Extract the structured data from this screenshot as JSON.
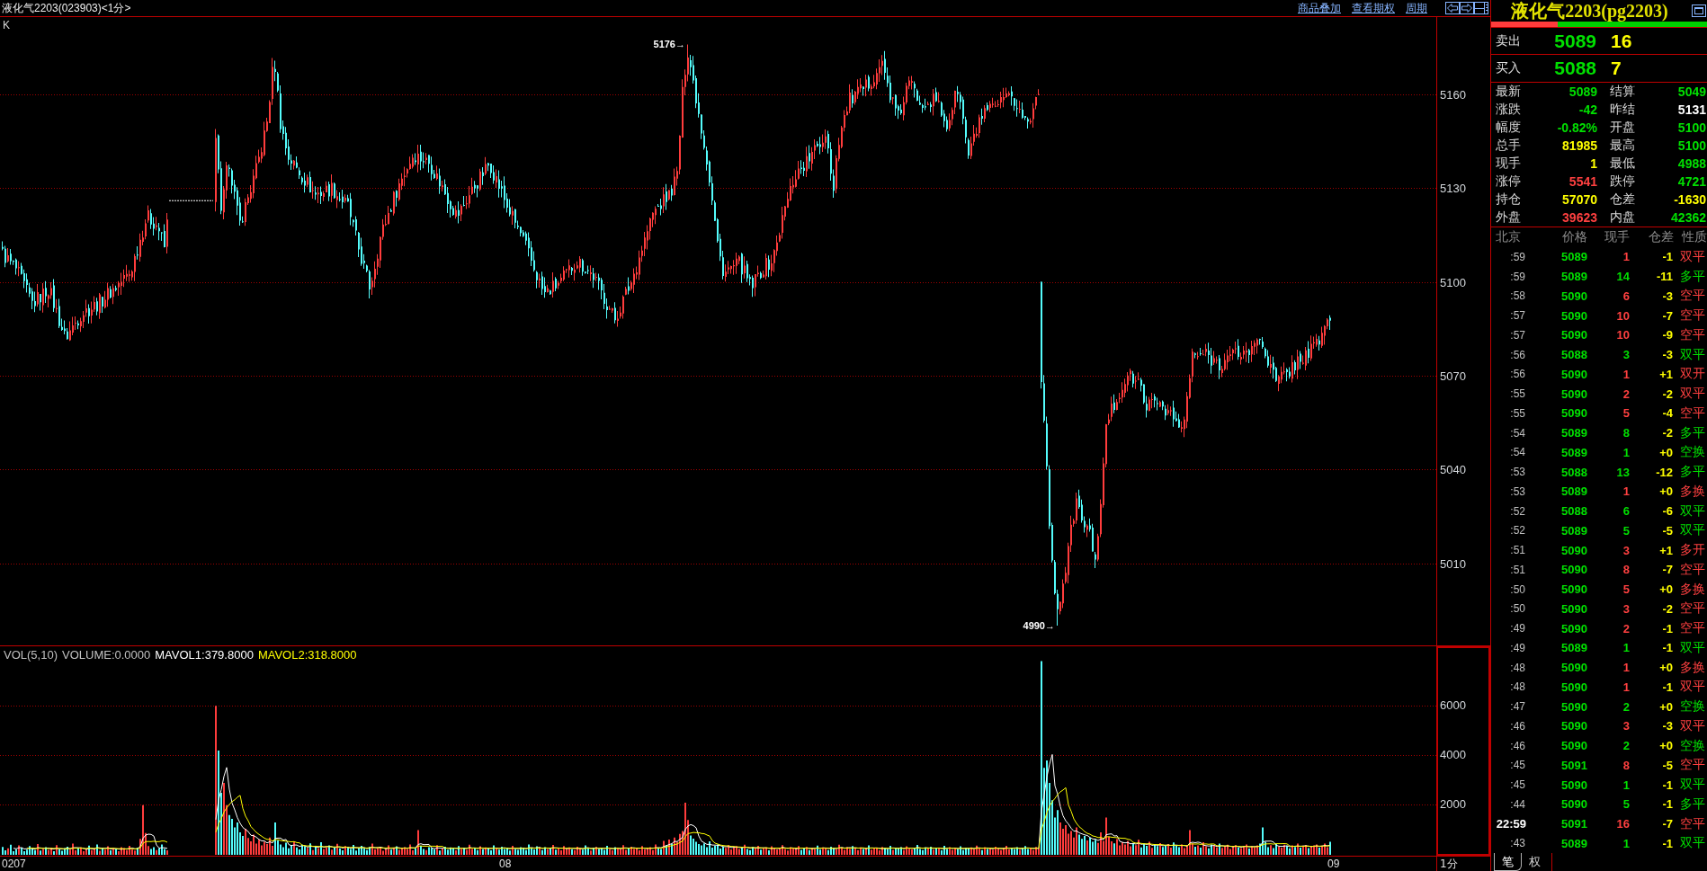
{
  "chart_window": {
    "title": "液化气2203(023903)<1分>",
    "links": [
      "商品叠加",
      "查看期权",
      "周期"
    ]
  },
  "price_pane": {
    "label": "K",
    "axis_labels": [
      "5160",
      "5130",
      "5100",
      "5070",
      "5040",
      "5010"
    ],
    "annotations": [
      {
        "text": "5176→"
      },
      {
        "text": "4990→"
      }
    ]
  },
  "volume_pane": {
    "indicators": [
      {
        "text": "VOL(5,10)",
        "color": "#c0c0c0"
      },
      {
        "text": "VOLUME:0.0000",
        "color": "#c0c0c0"
      },
      {
        "text": "MAVOL1:379.8000",
        "color": "#ffffff"
      },
      {
        "text": "MAVOL2:318.8000",
        "color": "#ffff00"
      }
    ],
    "axis_labels": [
      "6000",
      "4000",
      "2000"
    ]
  },
  "time_axis": {
    "labels": [
      "0207",
      "08",
      "09"
    ],
    "period": "1分"
  },
  "quote_panel": {
    "title": "液化气2203(pg2203)",
    "ratio": {
      "level": 0.31
    },
    "ask": {
      "label": "卖出",
      "price": "5089",
      "volume": "16"
    },
    "bid": {
      "label": "买入",
      "price": "5088",
      "volume": "7"
    },
    "stats": [
      {
        "label": "最新",
        "value": "5089",
        "color": "#00e000"
      },
      {
        "label": "结算",
        "value": "5049",
        "color": "#00e000"
      },
      {
        "label": "涨跌",
        "value": "-42",
        "color": "#00e000"
      },
      {
        "label": "昨结",
        "value": "5131",
        "color": "#ffffff"
      },
      {
        "label": "幅度",
        "value": "-0.82%",
        "color": "#00e000"
      },
      {
        "label": "开盘",
        "value": "5100",
        "color": "#00e000"
      },
      {
        "label": "总手",
        "value": "81985",
        "color": "#ffff00"
      },
      {
        "label": "最高",
        "value": "5100",
        "color": "#00e000"
      },
      {
        "label": "现手",
        "value": "1",
        "color": "#ffff00"
      },
      {
        "label": "最低",
        "value": "4988",
        "color": "#00e000"
      },
      {
        "label": "涨停",
        "value": "5541",
        "color": "#ff4040"
      },
      {
        "label": "跌停",
        "value": "4721",
        "color": "#00e000"
      },
      {
        "label": "持仓",
        "value": "57070",
        "color": "#ffff00"
      },
      {
        "label": "仓差",
        "value": "-1630",
        "color": "#ffff00"
      },
      {
        "label": "外盘",
        "value": "39623",
        "color": "#ff4040"
      },
      {
        "label": "内盘",
        "value": "42362",
        "color": "#00e000"
      }
    ],
    "ticks": {
      "columns": [
        "北京",
        "价格",
        "现手",
        "仓差",
        "性质"
      ],
      "rows": [
        {
          "kind": "second",
          "time": ":59",
          "price": "5089",
          "volume": "1",
          "change": "-1",
          "nature": "双平",
          "color": "#ff4040"
        },
        {
          "kind": "second",
          "time": ":59",
          "price": "5089",
          "volume": "14",
          "change": "-11",
          "nature": "多平",
          "color": "#00e000"
        },
        {
          "kind": "second",
          "time": ":58",
          "price": "5090",
          "volume": "6",
          "change": "-3",
          "nature": "空平",
          "color": "#ff4040"
        },
        {
          "kind": "second",
          "time": ":57",
          "price": "5090",
          "volume": "10",
          "change": "-7",
          "nature": "空平",
          "color": "#ff4040"
        },
        {
          "kind": "second",
          "time": ":57",
          "price": "5090",
          "volume": "10",
          "change": "-9",
          "nature": "空平",
          "color": "#ff4040"
        },
        {
          "kind": "second",
          "time": ":56",
          "price": "5088",
          "volume": "3",
          "change": "-3",
          "nature": "双平",
          "color": "#00e000"
        },
        {
          "kind": "second",
          "time": ":56",
          "price": "5090",
          "volume": "1",
          "change": "+1",
          "nature": "双开",
          "color": "#ff4040"
        },
        {
          "kind": "second",
          "time": ":55",
          "price": "5090",
          "volume": "2",
          "change": "-2",
          "nature": "双平",
          "color": "#ff4040"
        },
        {
          "kind": "second",
          "time": ":55",
          "price": "5090",
          "volume": "5",
          "change": "-4",
          "nature": "空平",
          "color": "#ff4040"
        },
        {
          "kind": "second",
          "time": ":54",
          "price": "5089",
          "volume": "8",
          "change": "-2",
          "nature": "多平",
          "color": "#00e000"
        },
        {
          "kind": "second",
          "time": ":54",
          "price": "5089",
          "volume": "1",
          "change": "+0",
          "nature": "空换",
          "color": "#00e000"
        },
        {
          "kind": "second",
          "time": ":53",
          "price": "5088",
          "volume": "13",
          "change": "-12",
          "nature": "多平",
          "color": "#00e000"
        },
        {
          "kind": "second",
          "time": ":53",
          "price": "5089",
          "volume": "1",
          "change": "+0",
          "nature": "多换",
          "color": "#ff4040"
        },
        {
          "kind": "second",
          "time": ":52",
          "price": "5088",
          "volume": "6",
          "change": "-6",
          "nature": "双平",
          "color": "#00e000"
        },
        {
          "kind": "second",
          "time": ":52",
          "price": "5089",
          "volume": "5",
          "change": "-5",
          "nature": "双平",
          "color": "#00e000"
        },
        {
          "kind": "second",
          "time": ":51",
          "price": "5090",
          "volume": "3",
          "change": "+1",
          "nature": "多开",
          "color": "#ff4040"
        },
        {
          "kind": "second",
          "time": ":51",
          "price": "5090",
          "volume": "8",
          "change": "-7",
          "nature": "空平",
          "color": "#ff4040"
        },
        {
          "kind": "second",
          "time": ":50",
          "price": "5090",
          "volume": "5",
          "change": "+0",
          "nature": "多换",
          "color": "#ff4040"
        },
        {
          "kind": "second",
          "time": ":50",
          "price": "5090",
          "volume": "3",
          "change": "-2",
          "nature": "空平",
          "color": "#ff4040"
        },
        {
          "kind": "second",
          "time": ":49",
          "price": "5090",
          "volume": "2",
          "change": "-1",
          "nature": "空平",
          "color": "#ff4040"
        },
        {
          "kind": "second",
          "time": ":49",
          "price": "5089",
          "volume": "1",
          "change": "-1",
          "nature": "双平",
          "color": "#00e000"
        },
        {
          "kind": "second",
          "time": ":48",
          "price": "5090",
          "volume": "1",
          "change": "+0",
          "nature": "多换",
          "color": "#ff4040"
        },
        {
          "kind": "second",
          "time": ":48",
          "price": "5090",
          "volume": "1",
          "change": "-1",
          "nature": "双平",
          "color": "#ff4040"
        },
        {
          "kind": "second",
          "time": ":47",
          "price": "5090",
          "volume": "2",
          "change": "+0",
          "nature": "空换",
          "color": "#00e000"
        },
        {
          "kind": "second",
          "time": ":46",
          "price": "5090",
          "volume": "3",
          "change": "-3",
          "nature": "双平",
          "color": "#ff4040"
        },
        {
          "kind": "second",
          "time": ":46",
          "price": "5090",
          "volume": "2",
          "change": "+0",
          "nature": "空换",
          "color": "#00e000"
        },
        {
          "kind": "second",
          "time": ":45",
          "price": "5091",
          "volume": "8",
          "change": "-5",
          "nature": "空平",
          "color": "#ff4040"
        },
        {
          "kind": "second",
          "time": ":45",
          "price": "5090",
          "volume": "1",
          "change": "-1",
          "nature": "双平",
          "color": "#00e000"
        },
        {
          "kind": "second",
          "time": ":44",
          "price": "5090",
          "volume": "5",
          "change": "-1",
          "nature": "多平",
          "color": "#00e000"
        },
        {
          "kind": "minute",
          "time": "22:59",
          "price": "5091",
          "volume": "16",
          "change": "-7",
          "nature": "空平",
          "color": "#ff4040"
        },
        {
          "kind": "second",
          "time": ":43",
          "price": "5089",
          "volume": "1",
          "change": "-1",
          "nature": "双平",
          "color": "#00e000"
        }
      ]
    },
    "tabs": [
      {
        "label": "笔",
        "selected": true
      },
      {
        "label": "权",
        "selected": false
      }
    ]
  }
}
